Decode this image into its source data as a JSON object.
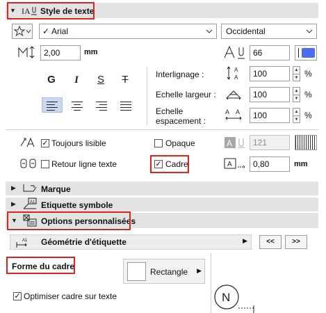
{
  "sections": {
    "text_style": "Style de texte",
    "marker": "Marque",
    "symbol_label": "Etiquette symbole",
    "custom_options": "Options personnalisées"
  },
  "font": {
    "name": "Arial",
    "encoding": "Occidental",
    "size": "2,00",
    "size_unit": "mm",
    "pen": "66",
    "pen_color": "#4a6cf0"
  },
  "format": {
    "bold": "G",
    "italic": "I",
    "underline": "S",
    "strike": "T"
  },
  "spacing": {
    "line_label": "Interlignage :",
    "line_value": "100",
    "width_label": "Echelle largeur :",
    "width_value": "100",
    "spacing_label_1": "Echelle",
    "spacing_label_2": "espacement :",
    "spacing_value": "100",
    "percent": "%"
  },
  "options": {
    "always_readable": "Toujours lisible",
    "always_readable_checked": true,
    "text_wrap": "Retour ligne texte",
    "text_wrap_checked": false,
    "opaque": "Opaque",
    "opaque_checked": false,
    "frame": "Cadre",
    "frame_checked": true,
    "opaque_pen": "121",
    "frame_offset": "0,80",
    "frame_offset_unit": "mm"
  },
  "geometry": {
    "label": "Géométrie d'étiquette",
    "prev": "<<",
    "next": ">>"
  },
  "frame_shape": {
    "title": "Forme du cadre",
    "shape": "Rectangle",
    "optimize": "Optimiser cadre sur texte",
    "optimize_checked": true,
    "preview_letter": "N"
  },
  "colors": {
    "highlight": "#e1241b",
    "header_bg": "#e3e3e3",
    "align_selected": "#c9d8ee"
  }
}
